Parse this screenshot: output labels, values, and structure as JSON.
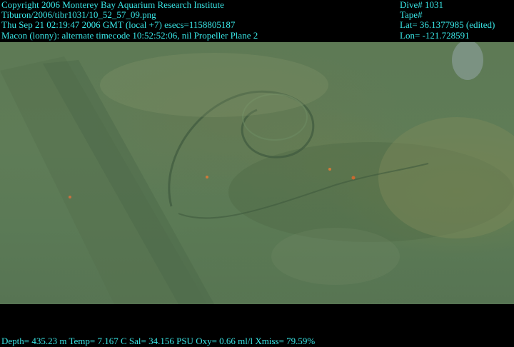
{
  "overlay": {
    "copyright": "Copyright 2006 Monterey Bay Aquarium Research Institute",
    "file_path": "Tiburon/2006/tibr1031/10_52_57_09.png",
    "datetime": "Thu Sep 21 02:19:47 2006 GMT (local +7)  esecs=1158805187",
    "timecode": "Macon (lonny): alternate timecode 10:52:52:06, nil Propeller Plane 2",
    "dive": "Dive# 1031",
    "tape": "Tape#",
    "lat": "Lat= 36.1377985 (edited)",
    "lon": "Lon= -121.728591",
    "sensors": "Depth= 435.23 m  Temp= 7.167 C  Sal= 34.156 PSU  Oxy= 0.66 ml/l  Xmiss= 79.59%"
  },
  "colors": {
    "overlay_text": "#39e6e6",
    "water": "#5f7c57",
    "background": "#000000"
  }
}
